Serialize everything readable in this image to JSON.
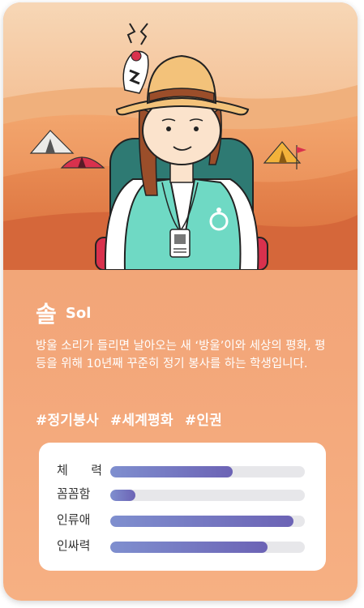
{
  "character": {
    "name_ko": "솔",
    "name_en": "Sol",
    "description": "방울 소리가 들리면 날아오는 새 ‘방울’이와 세상의 평화, 평등을 위해 10년째 꾸준히 정기 봉사를 하는 학생입니다.",
    "tags": [
      "#정기봉사",
      "#세계평화",
      "#인권"
    ]
  },
  "stats": [
    {
      "label": "체 력",
      "value": 0.63
    },
    {
      "label": "꼼꼼함",
      "value": 0.13
    },
    {
      "label": "인류애",
      "value": 0.94
    },
    {
      "label": "인싸력",
      "value": 0.81
    }
  ],
  "colors": {
    "card_background": "#f0a273",
    "bar_fill_start": "#7f8fcf",
    "bar_fill_end": "#6c63b5",
    "bar_track": "#e7e7ea",
    "vest": "#6fd9c4"
  }
}
